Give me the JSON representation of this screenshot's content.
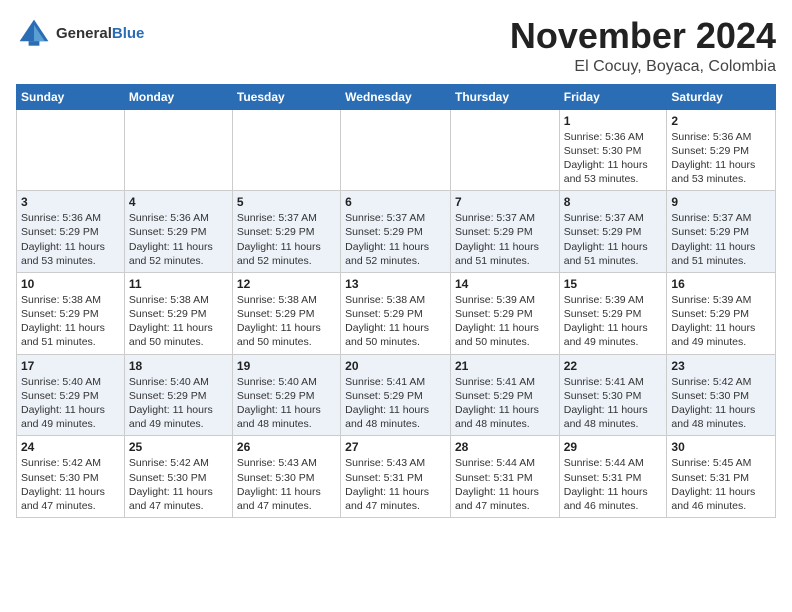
{
  "header": {
    "logo_general": "General",
    "logo_blue": "Blue",
    "month_title": "November 2024",
    "location": "El Cocuy, Boyaca, Colombia"
  },
  "days_of_week": [
    "Sunday",
    "Monday",
    "Tuesday",
    "Wednesday",
    "Thursday",
    "Friday",
    "Saturday"
  ],
  "weeks": [
    [
      {
        "day": "",
        "info": ""
      },
      {
        "day": "",
        "info": ""
      },
      {
        "day": "",
        "info": ""
      },
      {
        "day": "",
        "info": ""
      },
      {
        "day": "",
        "info": ""
      },
      {
        "day": "1",
        "info": "Sunrise: 5:36 AM\nSunset: 5:30 PM\nDaylight: 11 hours and 53 minutes."
      },
      {
        "day": "2",
        "info": "Sunrise: 5:36 AM\nSunset: 5:29 PM\nDaylight: 11 hours and 53 minutes."
      }
    ],
    [
      {
        "day": "3",
        "info": "Sunrise: 5:36 AM\nSunset: 5:29 PM\nDaylight: 11 hours and 53 minutes."
      },
      {
        "day": "4",
        "info": "Sunrise: 5:36 AM\nSunset: 5:29 PM\nDaylight: 11 hours and 52 minutes."
      },
      {
        "day": "5",
        "info": "Sunrise: 5:37 AM\nSunset: 5:29 PM\nDaylight: 11 hours and 52 minutes."
      },
      {
        "day": "6",
        "info": "Sunrise: 5:37 AM\nSunset: 5:29 PM\nDaylight: 11 hours and 52 minutes."
      },
      {
        "day": "7",
        "info": "Sunrise: 5:37 AM\nSunset: 5:29 PM\nDaylight: 11 hours and 51 minutes."
      },
      {
        "day": "8",
        "info": "Sunrise: 5:37 AM\nSunset: 5:29 PM\nDaylight: 11 hours and 51 minutes."
      },
      {
        "day": "9",
        "info": "Sunrise: 5:37 AM\nSunset: 5:29 PM\nDaylight: 11 hours and 51 minutes."
      }
    ],
    [
      {
        "day": "10",
        "info": "Sunrise: 5:38 AM\nSunset: 5:29 PM\nDaylight: 11 hours and 51 minutes."
      },
      {
        "day": "11",
        "info": "Sunrise: 5:38 AM\nSunset: 5:29 PM\nDaylight: 11 hours and 50 minutes."
      },
      {
        "day": "12",
        "info": "Sunrise: 5:38 AM\nSunset: 5:29 PM\nDaylight: 11 hours and 50 minutes."
      },
      {
        "day": "13",
        "info": "Sunrise: 5:38 AM\nSunset: 5:29 PM\nDaylight: 11 hours and 50 minutes."
      },
      {
        "day": "14",
        "info": "Sunrise: 5:39 AM\nSunset: 5:29 PM\nDaylight: 11 hours and 50 minutes."
      },
      {
        "day": "15",
        "info": "Sunrise: 5:39 AM\nSunset: 5:29 PM\nDaylight: 11 hours and 49 minutes."
      },
      {
        "day": "16",
        "info": "Sunrise: 5:39 AM\nSunset: 5:29 PM\nDaylight: 11 hours and 49 minutes."
      }
    ],
    [
      {
        "day": "17",
        "info": "Sunrise: 5:40 AM\nSunset: 5:29 PM\nDaylight: 11 hours and 49 minutes."
      },
      {
        "day": "18",
        "info": "Sunrise: 5:40 AM\nSunset: 5:29 PM\nDaylight: 11 hours and 49 minutes."
      },
      {
        "day": "19",
        "info": "Sunrise: 5:40 AM\nSunset: 5:29 PM\nDaylight: 11 hours and 48 minutes."
      },
      {
        "day": "20",
        "info": "Sunrise: 5:41 AM\nSunset: 5:29 PM\nDaylight: 11 hours and 48 minutes."
      },
      {
        "day": "21",
        "info": "Sunrise: 5:41 AM\nSunset: 5:29 PM\nDaylight: 11 hours and 48 minutes."
      },
      {
        "day": "22",
        "info": "Sunrise: 5:41 AM\nSunset: 5:30 PM\nDaylight: 11 hours and 48 minutes."
      },
      {
        "day": "23",
        "info": "Sunrise: 5:42 AM\nSunset: 5:30 PM\nDaylight: 11 hours and 48 minutes."
      }
    ],
    [
      {
        "day": "24",
        "info": "Sunrise: 5:42 AM\nSunset: 5:30 PM\nDaylight: 11 hours and 47 minutes."
      },
      {
        "day": "25",
        "info": "Sunrise: 5:42 AM\nSunset: 5:30 PM\nDaylight: 11 hours and 47 minutes."
      },
      {
        "day": "26",
        "info": "Sunrise: 5:43 AM\nSunset: 5:30 PM\nDaylight: 11 hours and 47 minutes."
      },
      {
        "day": "27",
        "info": "Sunrise: 5:43 AM\nSunset: 5:31 PM\nDaylight: 11 hours and 47 minutes."
      },
      {
        "day": "28",
        "info": "Sunrise: 5:44 AM\nSunset: 5:31 PM\nDaylight: 11 hours and 47 minutes."
      },
      {
        "day": "29",
        "info": "Sunrise: 5:44 AM\nSunset: 5:31 PM\nDaylight: 11 hours and 46 minutes."
      },
      {
        "day": "30",
        "info": "Sunrise: 5:45 AM\nSunset: 5:31 PM\nDaylight: 11 hours and 46 minutes."
      }
    ]
  ]
}
